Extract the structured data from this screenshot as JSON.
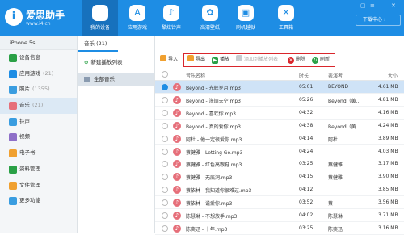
{
  "app": {
    "title": "爱思助手",
    "url": "www.i4.cn"
  },
  "nav": [
    {
      "label": "我的设备",
      "icon": "apple-icon",
      "glyph": ""
    },
    {
      "label": "应用游戏",
      "icon": "app-store-icon",
      "glyph": "A"
    },
    {
      "label": "酷炫铃声",
      "icon": "bell-icon",
      "glyph": "♪"
    },
    {
      "label": "高清壁纸",
      "icon": "flower-icon",
      "glyph": "✿"
    },
    {
      "label": "刷机越狱",
      "icon": "box-icon",
      "glyph": "▣"
    },
    {
      "label": "工具箱",
      "icon": "tools-icon",
      "glyph": "✕"
    }
  ],
  "download_button": "下载中心",
  "sidebar": {
    "device": "iPhone 5s",
    "items": [
      {
        "label": "设备信息",
        "count": "",
        "color": "#2aa046"
      },
      {
        "label": "应用游戏",
        "count": "(21)",
        "color": "#1e8de4"
      },
      {
        "label": "照片",
        "count": "(1355)",
        "color": "#3a9de0"
      },
      {
        "label": "音乐",
        "count": "(21)",
        "color": "#e66f7a"
      },
      {
        "label": "铃声",
        "count": "",
        "color": "#3a9de0"
      },
      {
        "label": "视频",
        "count": "",
        "color": "#8e6fc8"
      },
      {
        "label": "电子书",
        "count": "",
        "color": "#f0a030"
      },
      {
        "label": "资料管理",
        "count": "",
        "color": "#2aa046"
      },
      {
        "label": "文件管理",
        "count": "",
        "color": "#f0a030"
      },
      {
        "label": "更多功能",
        "count": "",
        "color": "#3a9de0"
      }
    ]
  },
  "playlist": {
    "tab": "音乐 (21)",
    "new": "新建播放列表",
    "all": "全部音乐"
  },
  "toolbar": {
    "import": "导入",
    "export": "导出",
    "play": "播放",
    "add_to_list": "添加到播放列表",
    "delete": "删除",
    "refresh": "刷新"
  },
  "table": {
    "headers": [
      "音乐名称",
      "时长",
      "表演者",
      "大小"
    ],
    "rows": [
      {
        "name": "Beyond - 光辉岁月.mp3",
        "time": "05:01",
        "artist": "BEYOND",
        "size": "4.61 MB",
        "sel": true
      },
      {
        "name": "Beyond - 海阔天空.mp3",
        "time": "05:26",
        "artist": "Beyond（黄…",
        "size": "4.81 MB",
        "sel": false
      },
      {
        "name": "Beyond - 喜欢你.mp3",
        "time": "04:32",
        "artist": "",
        "size": "4.16 MB",
        "sel": false
      },
      {
        "name": "Beyond - 真的爱你.mp3",
        "time": "04:38",
        "artist": "Beyond（黄…",
        "size": "4.24 MB",
        "sel": false
      },
      {
        "name": "阿杜 - 他一定很爱你.mp3",
        "time": "04:14",
        "artist": "阿杜",
        "size": "3.89 MB",
        "sel": false
      },
      {
        "name": "蔡健雅 - Letting Go.mp3",
        "time": "04:24",
        "artist": "",
        "size": "4.03 MB",
        "sel": false
      },
      {
        "name": "蔡健雅 - 红色高跟鞋.mp3",
        "time": "03:25",
        "artist": "蔡健雅",
        "size": "3.17 MB",
        "sel": false
      },
      {
        "name": "蔡健雅 - 无底洞.mp3",
        "time": "04:15",
        "artist": "蔡健雅",
        "size": "3.90 MB",
        "sel": false
      },
      {
        "name": "蔡依林 - 我知道你很难过.mp3",
        "time": "04:12",
        "artist": "",
        "size": "3.85 MB",
        "sel": false
      },
      {
        "name": "蔡依林 - 说爱你.mp3",
        "time": "03:52",
        "artist": "蔡",
        "size": "3.56 MB",
        "sel": false
      },
      {
        "name": "陈慧琳 - 不想放手.mp3",
        "time": "04:02",
        "artist": "陈慧琳",
        "size": "3.71 MB",
        "sel": false
      },
      {
        "name": "陈奕迅 - 十年.mp3",
        "time": "03:25",
        "artist": "陈奕迅",
        "size": "3.16 MB",
        "sel": false
      }
    ]
  }
}
